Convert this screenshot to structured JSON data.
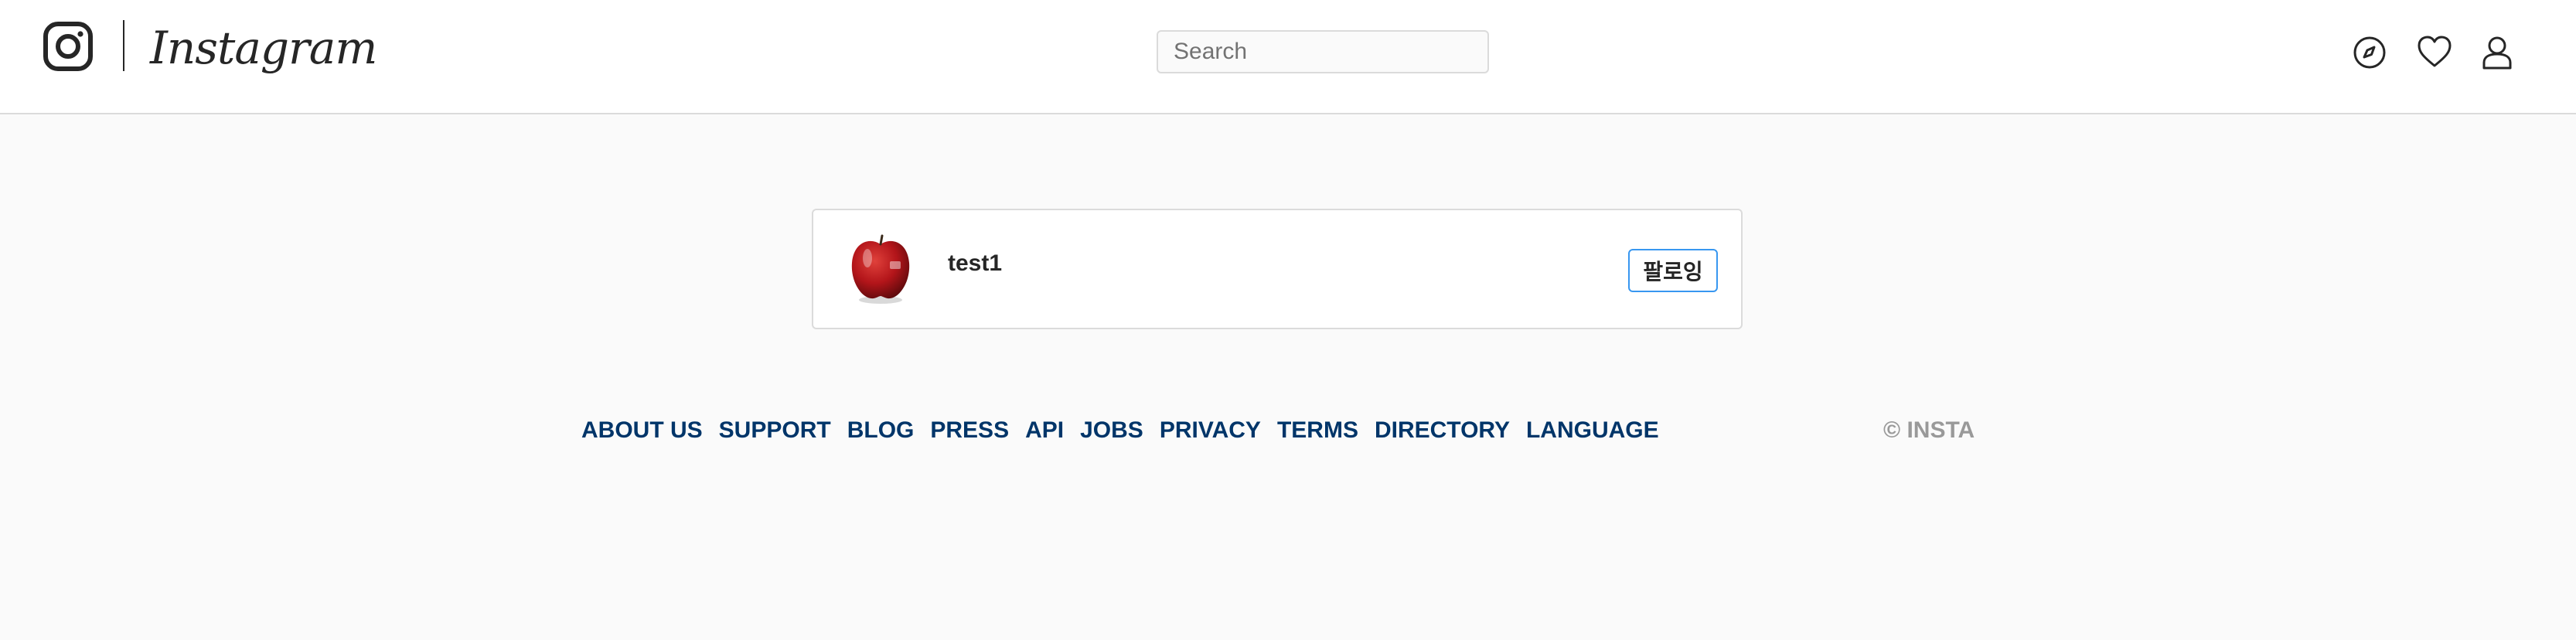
{
  "header": {
    "brand": "Instagram",
    "search_placeholder": "Search",
    "icons": [
      "instagram-glyph-icon",
      "compass-icon",
      "heart-icon",
      "user-icon"
    ]
  },
  "suggestion": {
    "username": "test1",
    "follow_label": "팔로잉",
    "avatar": "red-apple-image"
  },
  "footer": {
    "links": [
      "ABOUT US",
      "SUPPORT",
      "BLOG",
      "PRESS",
      "API",
      "JOBS",
      "PRIVACY",
      "TERMS",
      "DIRECTORY",
      "LANGUAGE"
    ],
    "copyright": "© INSTA"
  },
  "colors": {
    "background": "#fafafa",
    "border": "#dbdbdb",
    "link": "#003569",
    "button_border": "#3897f0",
    "copyright": "#999999"
  }
}
